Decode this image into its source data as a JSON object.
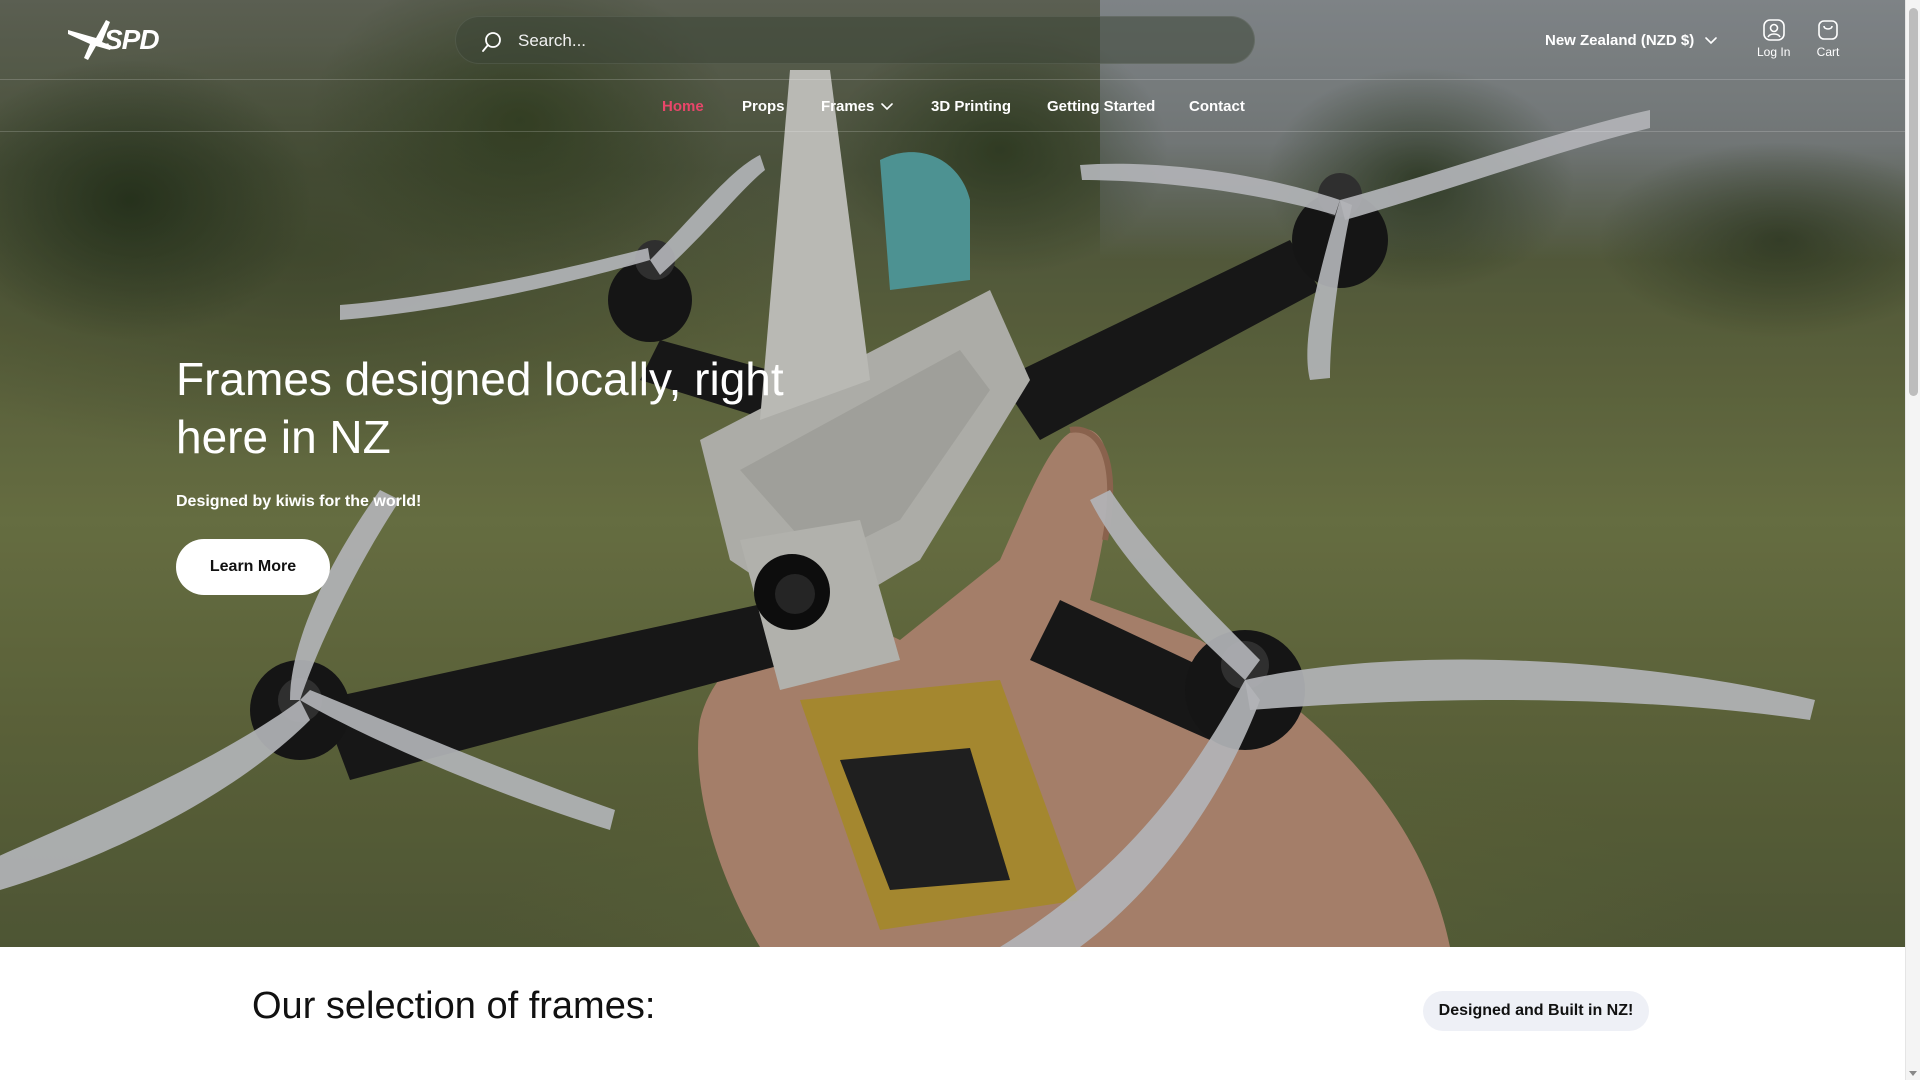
{
  "brand": {
    "logo_text": "SPD"
  },
  "search": {
    "placeholder": "Search...",
    "value": ""
  },
  "header": {
    "region": "New Zealand (NZD $)",
    "login_label": "Log In",
    "cart_label": "Cart"
  },
  "nav": {
    "items": [
      {
        "label": "Home",
        "active": true
      },
      {
        "label": "Props"
      },
      {
        "label": "Frames",
        "has_dropdown": true
      },
      {
        "label": "3D Printing"
      },
      {
        "label": "Getting Started"
      },
      {
        "label": "Contact"
      }
    ]
  },
  "hero": {
    "title": "Frames designed locally, right here in NZ",
    "subtitle": "Designed by kiwis for the world!",
    "button": "Learn More"
  },
  "section": {
    "title": "Our selection of frames:",
    "badge": "Designed and Built in NZ!"
  },
  "colors": {
    "active_nav": "#e8466a",
    "pill_bg": "#eef0f6"
  },
  "icons": [
    "search-icon",
    "chevron-down-icon",
    "user-circle-icon",
    "bag-icon"
  ]
}
